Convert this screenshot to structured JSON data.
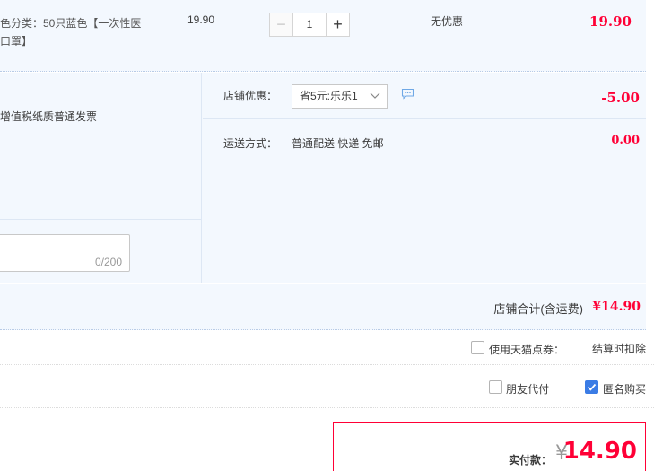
{
  "item": {
    "sku_line1": "色分类：50只蓝色【一次性医",
    "sku_line2": "口罩】",
    "unit_price": "19.90",
    "quantity": "1",
    "minus_symbol": "−",
    "plus_symbol": "+",
    "promo": "无优惠",
    "subtotal": "19.90"
  },
  "invoice": {
    "text": "增值税纸质普通发票"
  },
  "memo": {
    "counter": "0/200"
  },
  "store_discount": {
    "label": "店铺优惠：",
    "selected_option": "省5元:乐乐1",
    "amount": "-5.00"
  },
  "shipping": {
    "label": "运送方式：",
    "value": "普通配送 快递 免邮",
    "fee": "0.00"
  },
  "store_total": {
    "label": "店铺合计(含运费)",
    "value": "¥14.90"
  },
  "coupon": {
    "label": "使用天猫点券：",
    "note": "结算时扣除",
    "checked": false
  },
  "payment_options": {
    "friend_pay_label": "朋友代付",
    "friend_pay_checked": false,
    "anonymous_label": "匿名购买",
    "anonymous_checked": true
  },
  "final": {
    "label": "实付款：",
    "currency": "¥",
    "amount": "14.90"
  },
  "colors": {
    "accent_red": "#ff0036",
    "panel_bg": "#f3f8fe",
    "checkbox_blue": "#3b7ce5"
  },
  "icons": {
    "chat": "chat-bubble-icon",
    "dropdown": "chevron-down-icon",
    "check": "check-icon"
  }
}
